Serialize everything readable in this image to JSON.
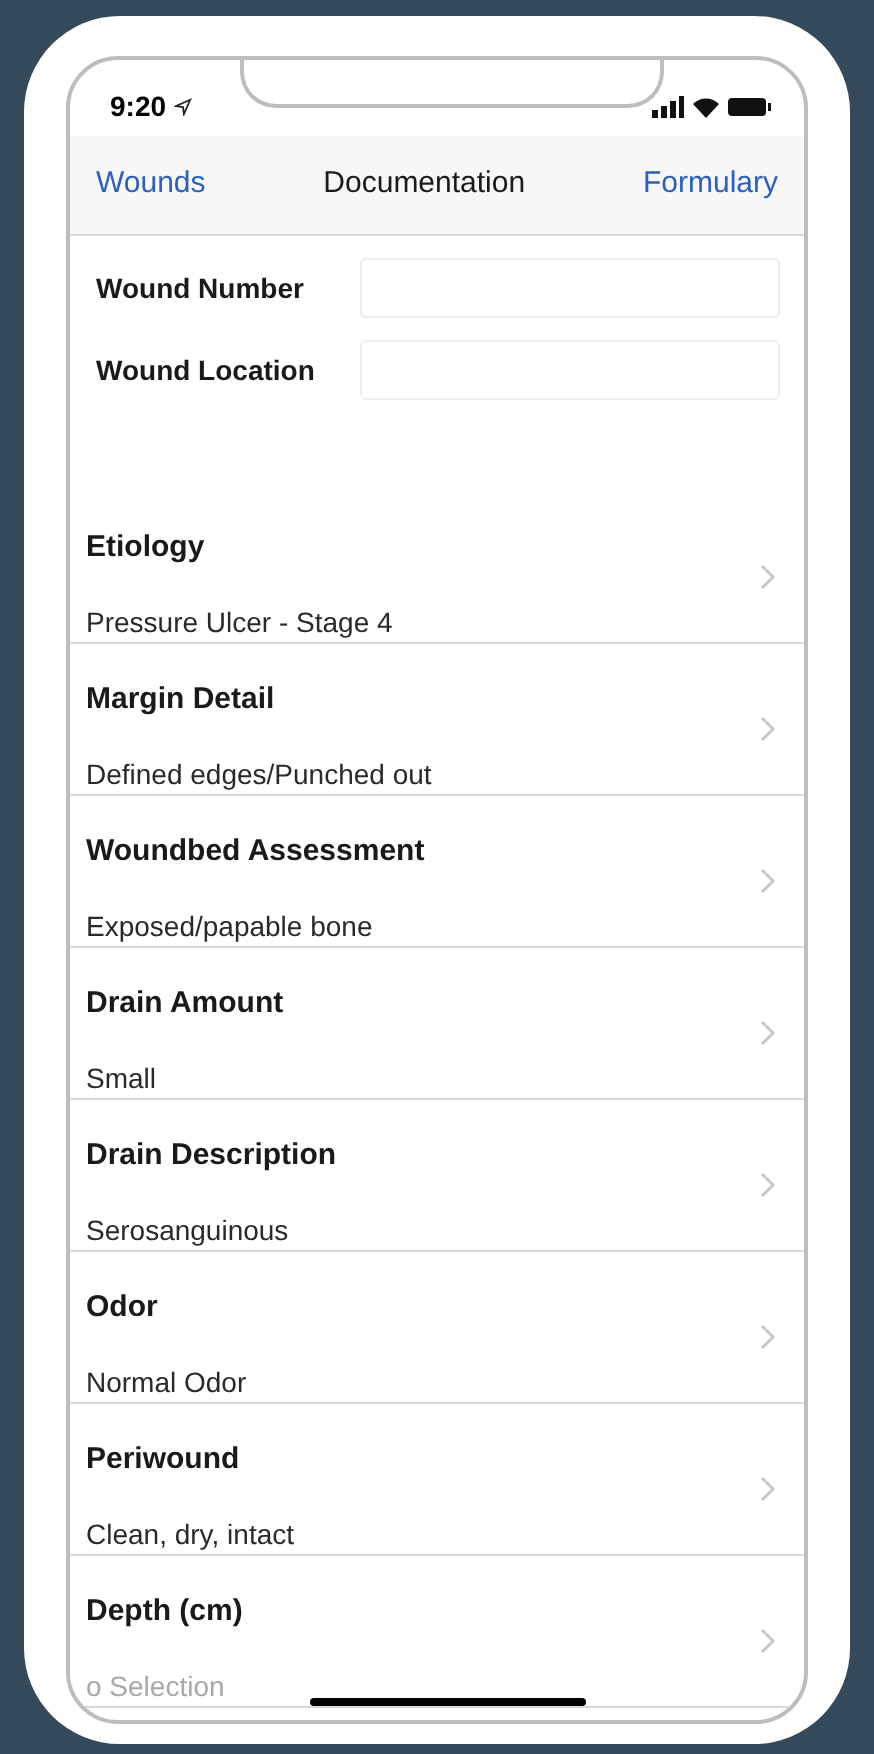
{
  "status_bar": {
    "time": "9:20"
  },
  "nav": {
    "back": "Wounds",
    "title": "Documentation",
    "action": "Formulary"
  },
  "fields": [
    {
      "label": "Wound Number"
    },
    {
      "label": "Wound Location"
    }
  ],
  "rows": [
    {
      "title": "Etiology",
      "value": "Pressure Ulcer - Stage 4",
      "muted": false
    },
    {
      "title": "Margin Detail",
      "value": "Defined edges/Punched out",
      "muted": false
    },
    {
      "title": "Woundbed Assessment",
      "value": "Exposed/papable bone",
      "muted": false
    },
    {
      "title": "Drain Amount",
      "value": "Small",
      "muted": false
    },
    {
      "title": "Drain Description",
      "value": "Serosanguinous",
      "muted": false
    },
    {
      "title": "Odor",
      "value": "Normal Odor",
      "muted": false
    },
    {
      "title": "Periwound",
      "value": "Clean, dry, intact",
      "muted": false
    },
    {
      "title": "Depth (cm)",
      "value": "o Selection",
      "muted": true
    }
  ]
}
